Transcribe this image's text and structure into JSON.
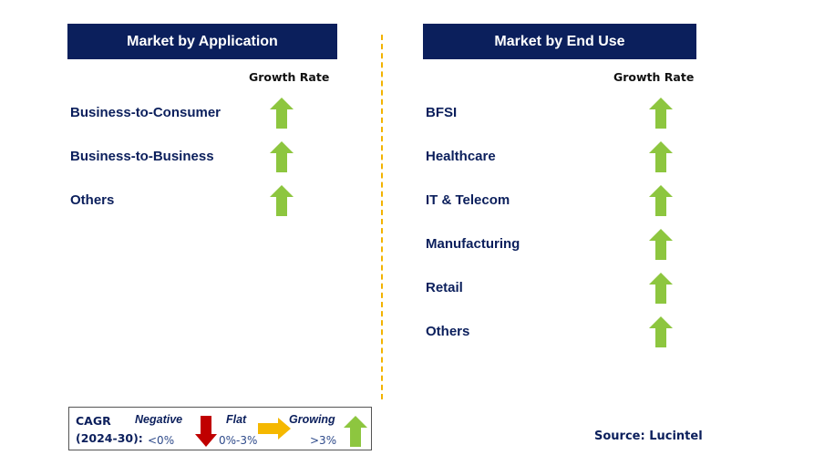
{
  "left_panel": {
    "title": "Market by Application",
    "growth_header": "Growth Rate",
    "items": [
      {
        "label": "Business-to-Consumer",
        "trend": "growing"
      },
      {
        "label": "Business-to-Business",
        "trend": "growing"
      },
      {
        "label": "Others",
        "trend": "growing"
      }
    ]
  },
  "right_panel": {
    "title": "Market by End Use",
    "growth_header": "Growth Rate",
    "items": [
      {
        "label": "BFSI",
        "trend": "growing"
      },
      {
        "label": "Healthcare",
        "trend": "growing"
      },
      {
        "label": "IT & Telecom",
        "trend": "growing"
      },
      {
        "label": "Manufacturing",
        "trend": "growing"
      },
      {
        "label": "Retail",
        "trend": "growing"
      },
      {
        "label": "Others",
        "trend": "growing"
      }
    ]
  },
  "legend": {
    "cagr_line1": "CAGR",
    "cagr_line2": "(2024-30):",
    "negative_label": "Negative",
    "negative_range": "<0%",
    "flat_label": "Flat",
    "flat_range": "0%-3%",
    "growing_label": "Growing",
    "growing_range": ">3%"
  },
  "source": "Source: Lucintel",
  "colors": {
    "header_bg": "#0b1f5c",
    "growing": "#8dc63f",
    "flat": "#f5b800",
    "negative": "#c00000",
    "divider": "#f2b300"
  }
}
